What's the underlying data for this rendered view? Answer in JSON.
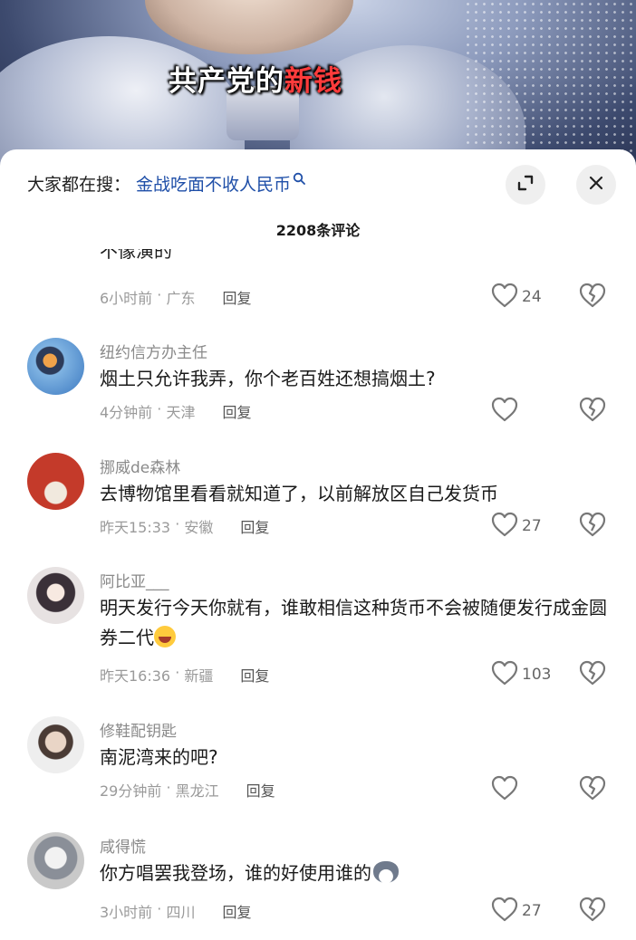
{
  "video": {
    "caption_white": "共产党的",
    "caption_red": "新钱"
  },
  "header": {
    "search_prefix": "大家都在搜：",
    "search_term": "金战吃面不收人民币",
    "comment_count": "2208条评论"
  },
  "clipped_comment": {
    "text": "不像演的",
    "time": "6小时前",
    "location": "广东",
    "reply": "回复",
    "likes": "24"
  },
  "comments": [
    {
      "name": "纽约信方办主任",
      "text": "烟土只允许我弄，你个老百姓还想搞烟土?",
      "time": "4分钟前",
      "location": "天津",
      "reply": "回复",
      "likes": ""
    },
    {
      "name": "挪威de森林",
      "text": "去博物馆里看看就知道了，以前解放区自己发货币",
      "time": "昨天15:33",
      "location": "安徽",
      "reply": "回复",
      "likes": "27"
    },
    {
      "name": "阿比亚___",
      "text": "明天发行今天你就有，谁敢相信这种货币不会被随便发行成金圆券二代",
      "time": "昨天16:36",
      "location": "新疆",
      "reply": "回复",
      "likes": "103"
    },
    {
      "name": "修鞋配钥匙",
      "text": "南泥湾来的吧?",
      "time": "29分钟前",
      "location": "黑龙江",
      "reply": "回复",
      "likes": ""
    },
    {
      "name": "咸得慌",
      "text": "你方唱罢我登场，谁的好使用谁的",
      "time": "3小时前",
      "location": "四川",
      "reply": "回复",
      "likes": "27"
    }
  ],
  "icons": {
    "expand": "expand-icon",
    "close": "close-icon",
    "like": "heart-icon",
    "dislike": "broken-heart-icon",
    "search": "search-icon"
  },
  "colors": {
    "link_blue": "#1f4fa8",
    "caption_red": "#ff3b3b",
    "meta_gray": "#9a9a9a"
  }
}
